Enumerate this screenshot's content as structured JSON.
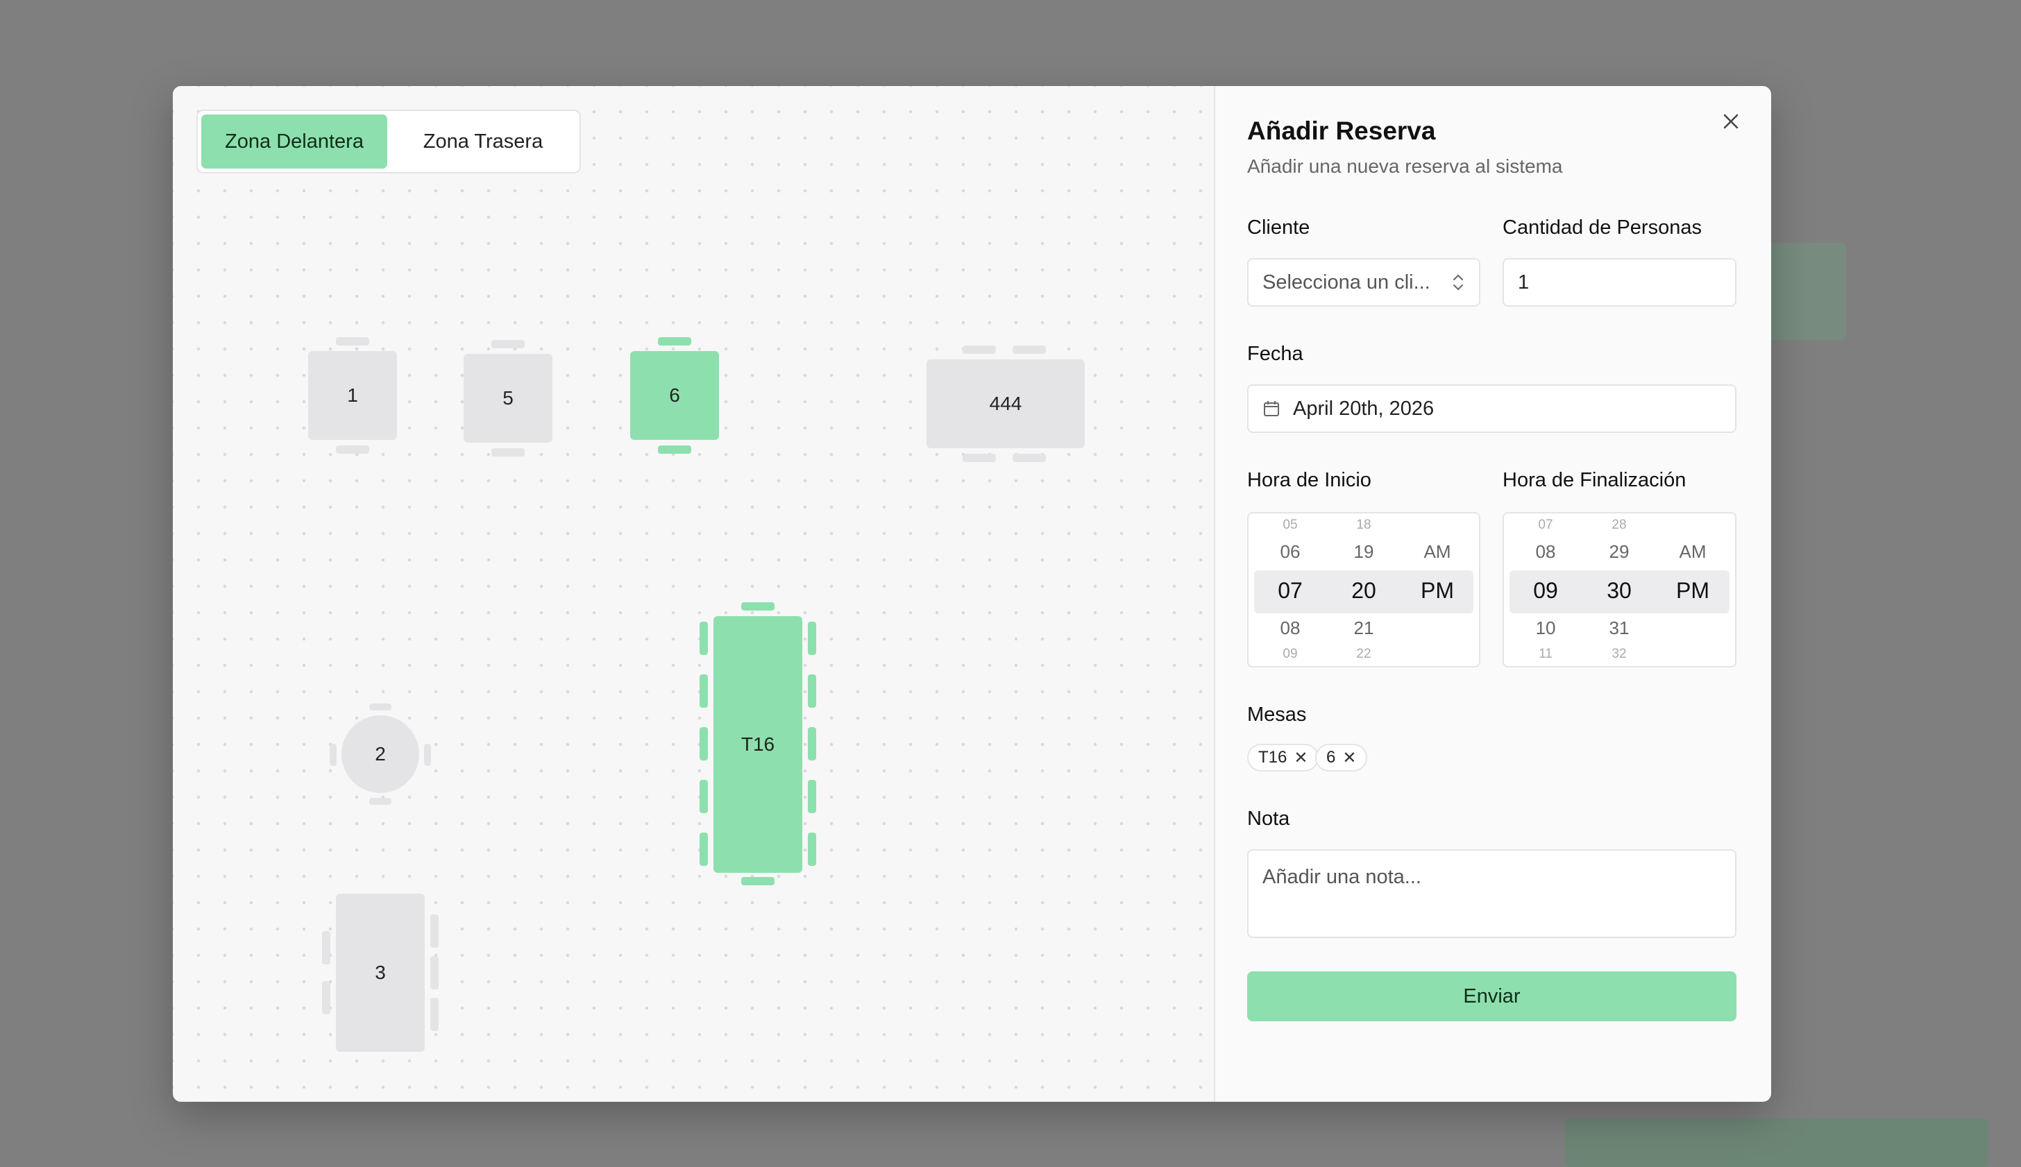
{
  "zones": {
    "front_label": "Zona Delantera",
    "back_label": "Zona Trasera",
    "active": "front"
  },
  "tables": [
    {
      "label": "1",
      "selected": false
    },
    {
      "label": "5",
      "selected": false
    },
    {
      "label": "6",
      "selected": true
    },
    {
      "label": "444",
      "selected": false
    },
    {
      "label": "2",
      "selected": false
    },
    {
      "label": "T16",
      "selected": true
    },
    {
      "label": "3",
      "selected": false
    }
  ],
  "dialog": {
    "title": "Añadir Reserva",
    "subtitle": "Añadir una nueva reserva al sistema",
    "close_icon": "close-icon"
  },
  "form": {
    "client_label": "Cliente",
    "client_placeholder": "Selecciona un cli...",
    "people_label": "Cantidad de Personas",
    "people_value": "1",
    "date_label": "Fecha",
    "date_value": "April 20th, 2026",
    "start_label": "Hora de Inicio",
    "end_label": "Hora de Finalización",
    "start_time": {
      "hours": [
        "05",
        "06",
        "07",
        "08",
        "09"
      ],
      "minutes": [
        "18",
        "19",
        "20",
        "21",
        "22"
      ],
      "ampm": [
        "AM",
        "PM"
      ]
    },
    "end_time": {
      "hours": [
        "07",
        "08",
        "09",
        "10",
        "11"
      ],
      "minutes": [
        "28",
        "29",
        "30",
        "31",
        "32"
      ],
      "ampm": [
        "AM",
        "PM"
      ]
    },
    "tables_label": "Mesas",
    "selected_tables": [
      "T16",
      "6"
    ],
    "note_label": "Nota",
    "note_placeholder": "Añadir una nota...",
    "submit_label": "Enviar"
  },
  "colors": {
    "accent": "#8de0ad",
    "table": "#e4e4e7"
  }
}
